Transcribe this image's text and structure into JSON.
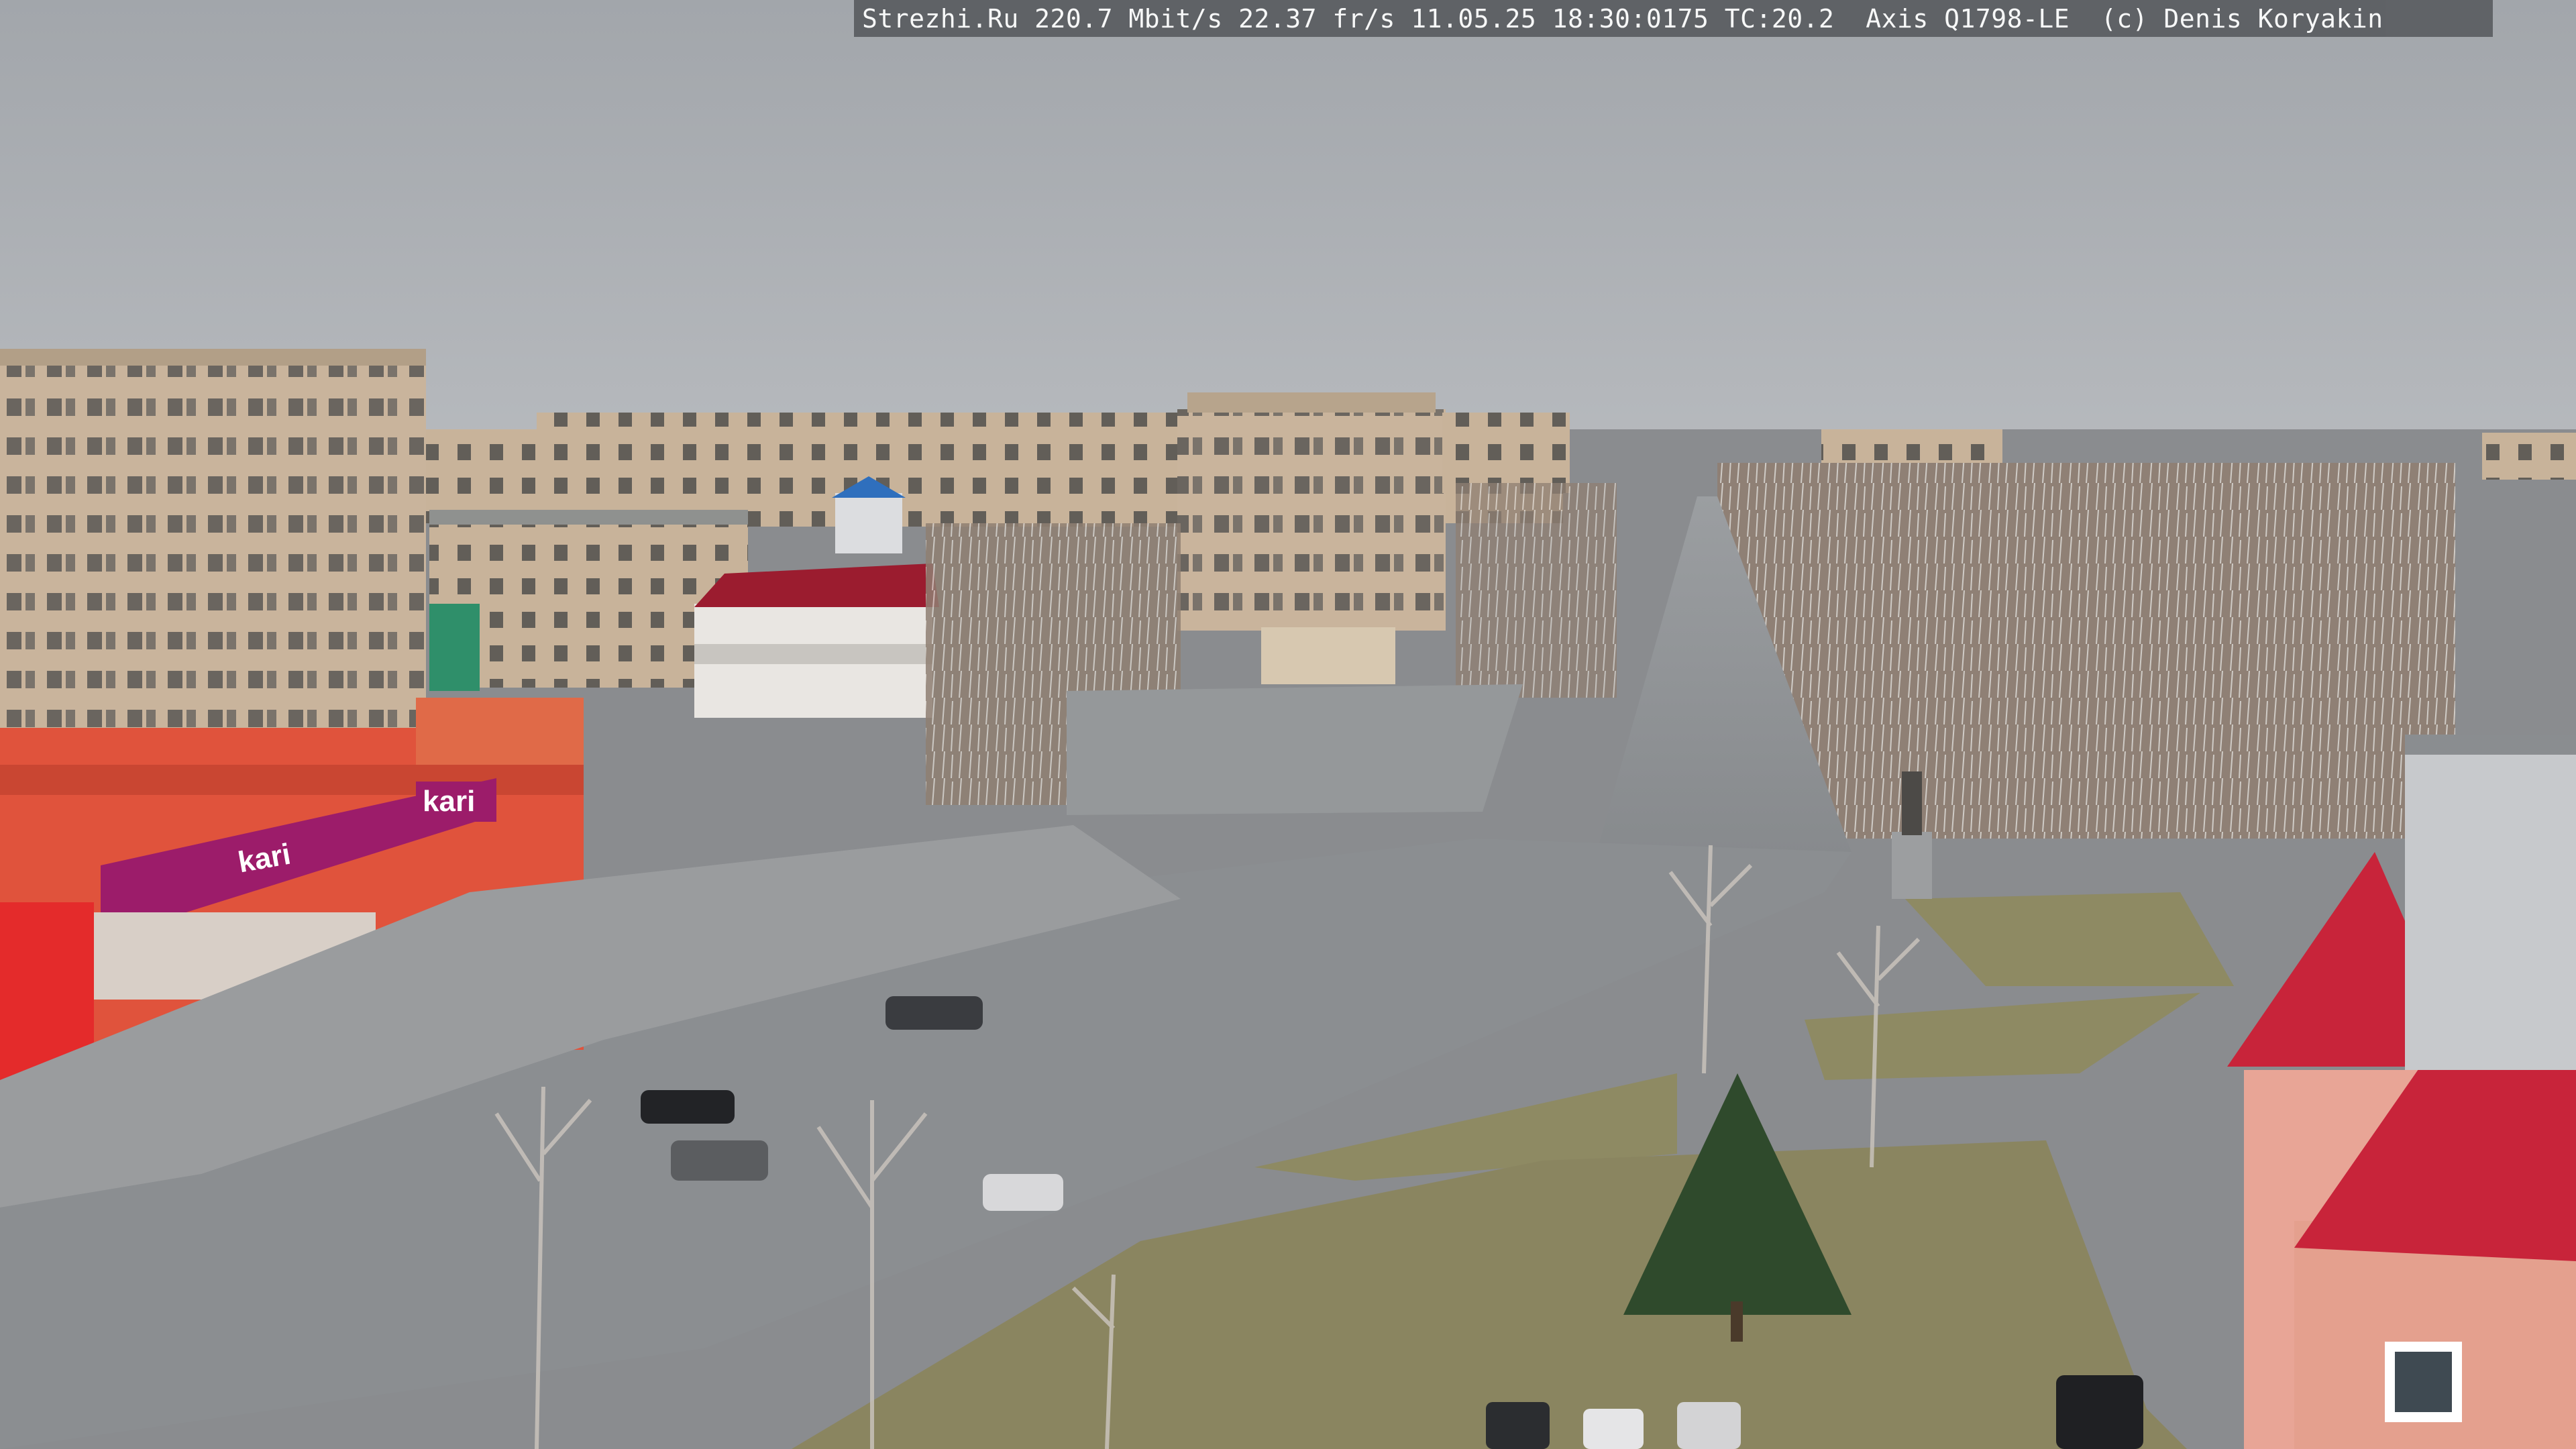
{
  "camera_overlay": {
    "text": "Strezhi.Ru 220.7 Mbit/s 22.37 fr/s 11.05.25 18:30:0175 TC:20.2  Axis Q1798-LE  (c) Denis Koryakin"
  },
  "store_signs": {
    "kari_facade": "kari",
    "kari_banner": "kari"
  },
  "colors": {
    "sky": "#a9adb2",
    "asphalt": "#8d8f93",
    "storefront_red": "#e0533c",
    "kari_magenta": "#9c1c6a",
    "roof_red": "#c8243a",
    "lawn": "#8e8a63"
  }
}
